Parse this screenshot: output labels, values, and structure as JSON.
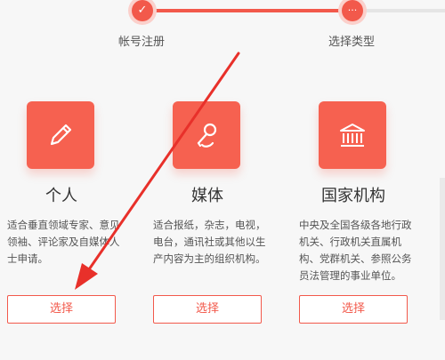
{
  "steps": [
    {
      "label": "帐号注册",
      "icon": "check-icon",
      "glyph": "✓"
    },
    {
      "label": "选择类型",
      "icon": "more-icon",
      "glyph": "···"
    }
  ],
  "cards": [
    {
      "title": "个人",
      "icon": "pencil-icon",
      "desc": "适合垂直领域专家、意见领袖、评论家及自媒体人士申请。",
      "button": "选择"
    },
    {
      "title": "媒体",
      "icon": "microphone-icon",
      "desc": "适合报纸，杂志，电视，电台，通讯社或其他以生产内容为主的组织机构。",
      "button": "选择"
    },
    {
      "title": "国家机构",
      "icon": "government-building-icon",
      "desc": "中央及全国各级各地行政机关、行政机关直属机构、党群机关、参照公务员法管理的事业单位。",
      "button": "选择"
    }
  ],
  "colors": {
    "accent": "#f2594b",
    "tile": "#f66150",
    "arrow": "#e8302a"
  }
}
